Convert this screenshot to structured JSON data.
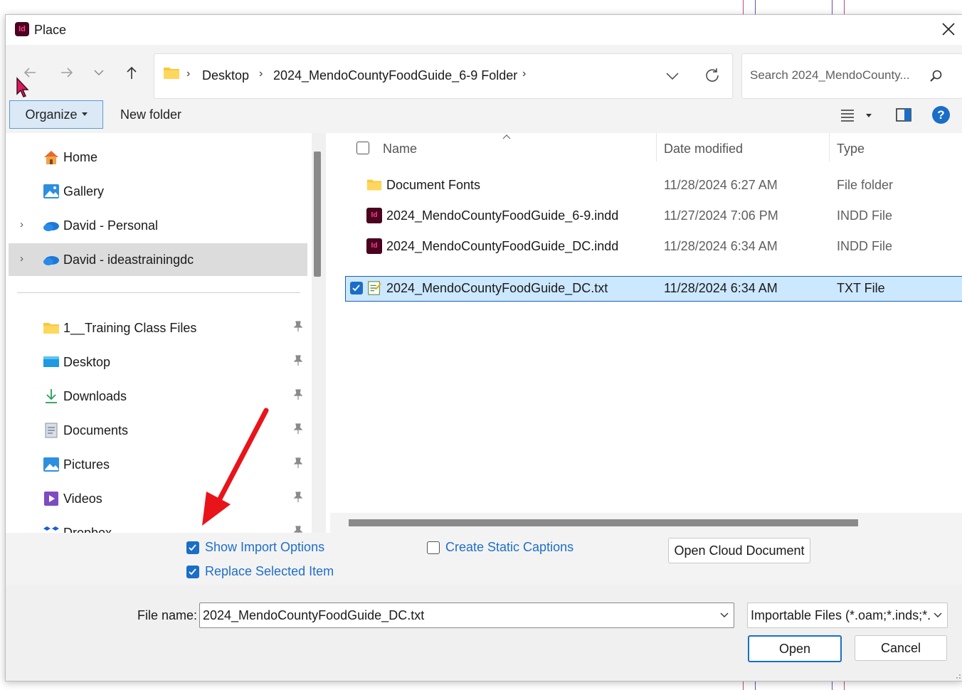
{
  "window": {
    "app_icon": "Id",
    "title": "Place"
  },
  "breadcrumb": {
    "items": [
      "Desktop",
      "2024_MendoCountyFoodGuide_6-9 Folder"
    ]
  },
  "search": {
    "placeholder": "Search 2024_MendoCounty..."
  },
  "toolbar": {
    "organize_label": "Organize",
    "new_folder_label": "New folder"
  },
  "sidebar": {
    "quick_items": [
      {
        "label": "Home",
        "icon": "home-icon"
      },
      {
        "label": "Gallery",
        "icon": "gallery-icon"
      },
      {
        "label": "David - Personal",
        "icon": "onedrive-icon"
      },
      {
        "label": "David - ideastrainingdc",
        "icon": "onedrive-icon",
        "selected": true
      }
    ],
    "pinned_items": [
      {
        "label": "1__Training Class Files",
        "icon": "folder-icon"
      },
      {
        "label": "Desktop",
        "icon": "desktop-icon"
      },
      {
        "label": "Downloads",
        "icon": "download-icon"
      },
      {
        "label": "Documents",
        "icon": "documents-icon"
      },
      {
        "label": "Pictures",
        "icon": "pictures-icon"
      },
      {
        "label": "Videos",
        "icon": "videos-icon"
      },
      {
        "label": "Dropbox",
        "icon": "dropbox-icon"
      }
    ]
  },
  "file_list": {
    "columns": [
      "Name",
      "Date modified",
      "Type"
    ],
    "rows": [
      {
        "name": "Document Fonts",
        "date": "11/28/2024 6:27 AM",
        "type": "File folder",
        "icon": "folder-icon"
      },
      {
        "name": "2024_MendoCountyFoodGuide_6-9.indd",
        "date": "11/27/2024 7:06 PM",
        "type": "INDD File",
        "icon": "indesign-file-icon"
      },
      {
        "name": "2024_MendoCountyFoodGuide_DC.indd",
        "date": "11/28/2024 6:34 AM",
        "type": "INDD File",
        "icon": "indesign-file-icon"
      },
      {
        "name": "2024_MendoCountyFoodGuide_DC.txt",
        "date": "11/28/2024 6:34 AM",
        "type": "TXT File",
        "icon": "text-file-icon",
        "selected": true
      }
    ]
  },
  "options": {
    "show_import_options": {
      "label": "Show Import Options",
      "checked": true
    },
    "replace_selected_item": {
      "label": "Replace Selected Item",
      "checked": true
    },
    "create_static_captions": {
      "label": "Create Static Captions",
      "checked": false
    },
    "open_cloud_document": "Open Cloud Document"
  },
  "footer": {
    "file_name_label": "File name:",
    "file_name_value": "2024_MendoCountyFoodGuide_DC.txt",
    "file_type_value": "Importable Files (*.oam;*.inds;*.",
    "open_label": "Open",
    "cancel_label": "Cancel"
  },
  "colors": {
    "accent": "#1a6ec7",
    "selection": "#cce8ff",
    "annotation_arrow": "#e8141a"
  }
}
